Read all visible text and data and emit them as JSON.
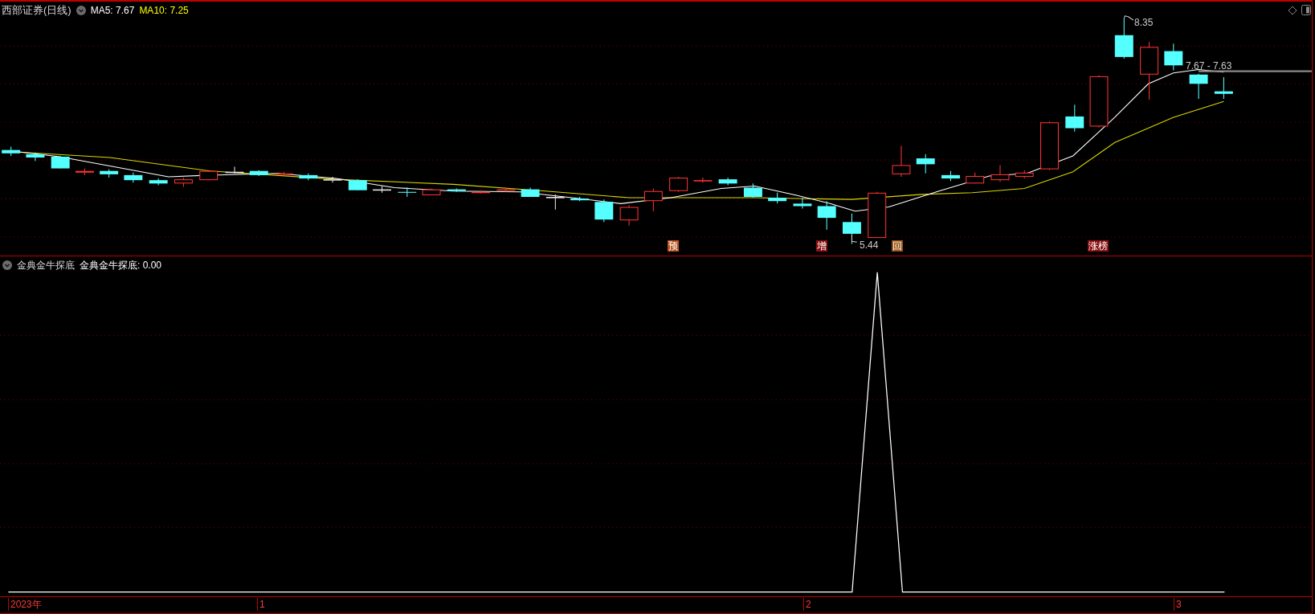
{
  "chart": {
    "title": "西部证券(日线)",
    "ma5": "MA5: 7.67",
    "ma10": "MA10: 7.25",
    "high_label": "8.35",
    "low_label": "5.44",
    "last_label": "7.67 - 7.63",
    "markers": [
      {
        "text": "预",
        "color": "#b8501c"
      },
      {
        "text": "增",
        "color": "#8b1010"
      },
      {
        "text": "回",
        "color": "#9a5418"
      },
      {
        "text": "涨榜",
        "color": "#8b1010"
      }
    ]
  },
  "indicator": {
    "name": "金典金牛探底",
    "reading": "金典金牛探底: 0.00"
  },
  "time_axis": [
    "2023年",
    "1",
    "2",
    "3"
  ]
}
